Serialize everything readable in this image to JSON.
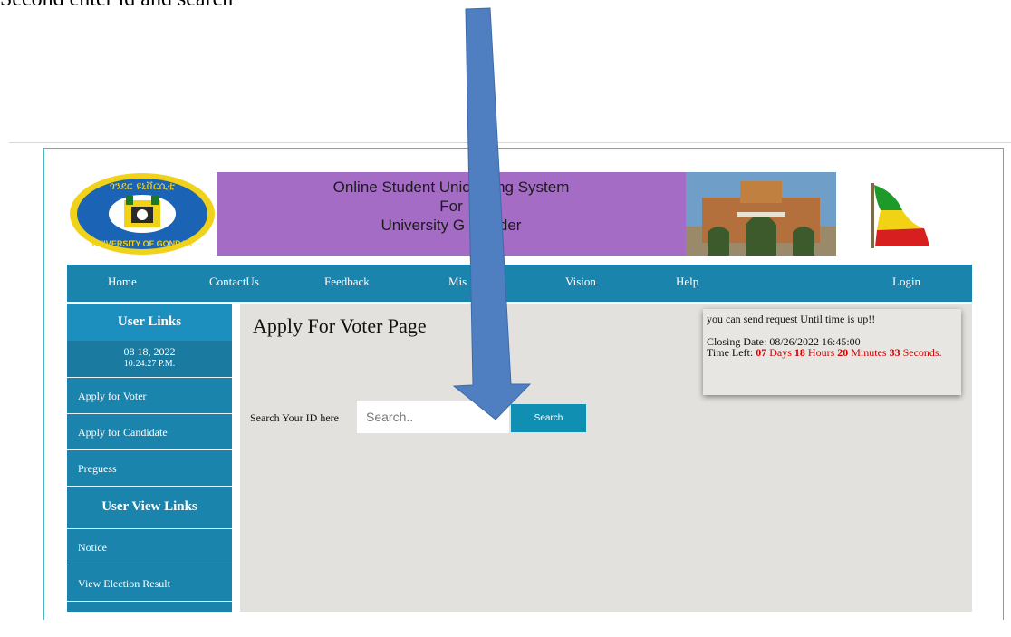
{
  "caption": "Second enter id and search",
  "banner": {
    "logo_text_top": "ጎንደር ዩኒቨርሲቲ",
    "logo_text_bottom": "UNIVERSITY OF GONDAR",
    "line1": "Online Student Unior    ing System",
    "line2": "For",
    "line3": "University G    onder"
  },
  "nav": [
    "Home",
    "ContactUs",
    "Feedback",
    "Mis",
    "Vision",
    "Help",
    "Login"
  ],
  "sidebar": {
    "user_links_heading": "User Links",
    "date": "08 18, 2022",
    "time": "10:24:27 P.M.",
    "links": [
      "Apply for Voter",
      "Apply for Candidate",
      "Preguess"
    ],
    "user_view_heading": "User View Links",
    "view_links": [
      "Notice",
      "View Election Result"
    ]
  },
  "main": {
    "title": "Apply For Voter Page",
    "search_label": "Search Your ID here",
    "search_placeholder": "Search..",
    "search_button": "Search"
  },
  "notice": {
    "line1": "you can send request Until time is up!!",
    "closing_label": "Closing Date: 08/26/2022 16:45:00",
    "time_left_label": "Time Left:",
    "days_num": "07",
    "days_word": "Days",
    "hours_num": "18",
    "hours_word": "Hours",
    "minutes_num": "20",
    "minutes_word": "Minutes",
    "seconds_num": "33",
    "seconds_word": "Seconds."
  },
  "colors": {
    "nav_blue": "#1a84ad",
    "banner_purple": "#a56cc6",
    "button_blue": "#118fb2",
    "arrow_blue": "#4f7fc0",
    "countdown_red": "#d40000"
  }
}
